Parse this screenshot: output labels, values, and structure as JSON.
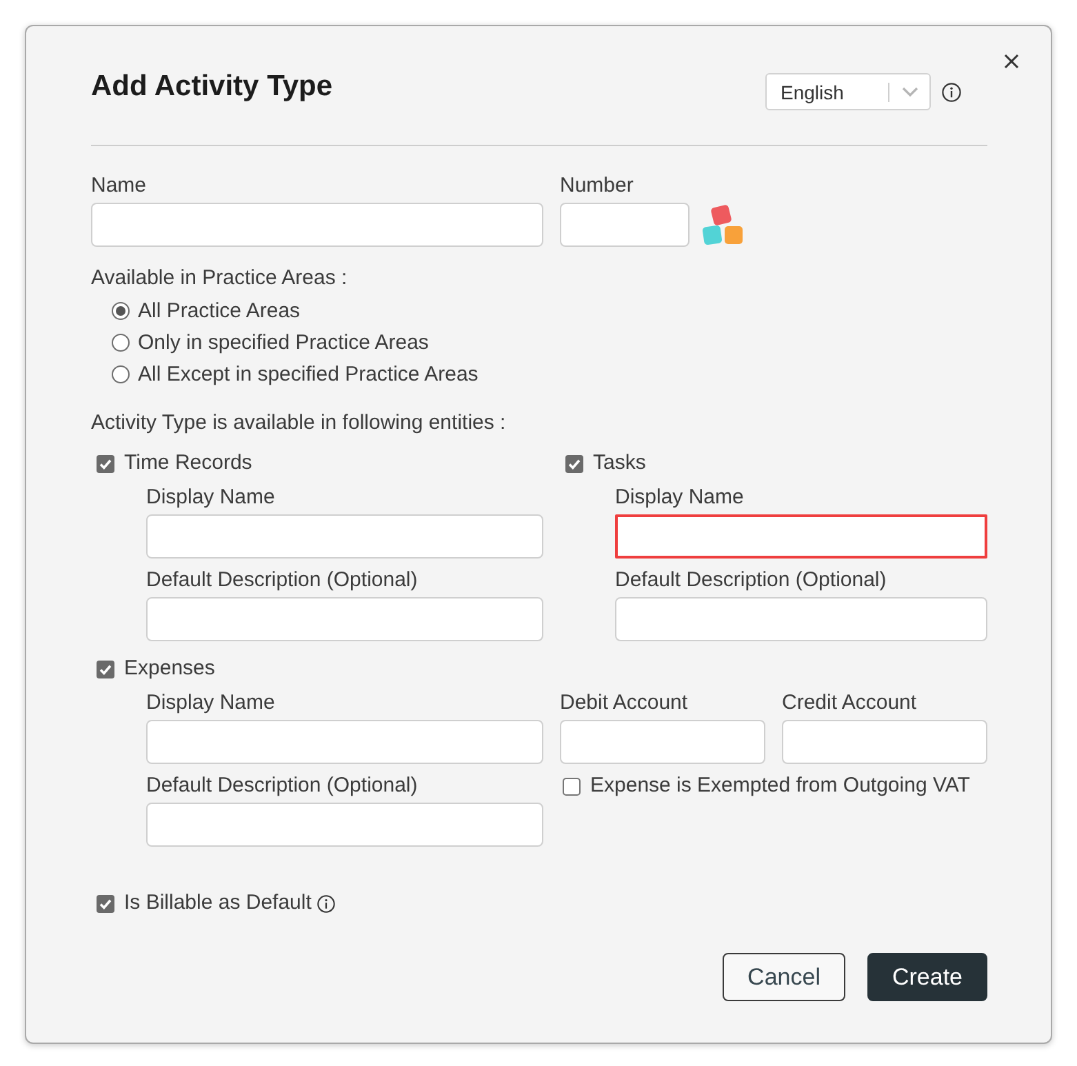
{
  "dialog": {
    "title": "Add Activity Type",
    "language_select": {
      "value": "English"
    }
  },
  "name_field": {
    "label": "Name"
  },
  "number_field": {
    "label": "Number"
  },
  "practice_areas": {
    "label": "Available in Practice Areas :",
    "options": [
      {
        "label": "All Practice Areas",
        "selected": true
      },
      {
        "label": "Only in specified Practice Areas",
        "selected": false
      },
      {
        "label": "All Except in specified Practice Areas",
        "selected": false
      }
    ]
  },
  "entities": {
    "label": "Activity Type is available in following entities :",
    "groups": [
      {
        "kind": "half",
        "label": "Time Records",
        "checked": true,
        "fields": [
          {
            "label": "Display Name",
            "error": false
          },
          {
            "label": "Default Description (Optional)",
            "error": false
          }
        ]
      },
      {
        "kind": "half",
        "label": "Tasks",
        "checked": true,
        "fields": [
          {
            "label": "Display Name",
            "error": true
          },
          {
            "label": "Default Description (Optional)",
            "error": false
          }
        ]
      },
      {
        "kind": "full",
        "label": "Expenses",
        "checked": true,
        "fields": [
          {
            "label": "Display Name",
            "error": false
          },
          {
            "label": "Default Description (Optional)",
            "error": false
          }
        ],
        "accounts": [
          {
            "label": "Debit Account",
            "error": false
          },
          {
            "label": "Credit Account",
            "error": false
          }
        ],
        "exemption": {
          "label": "Expense is Exempted from Outgoing VAT",
          "checked": false
        }
      }
    ]
  },
  "billable": {
    "label": "Is Billable as Default",
    "checked": true
  },
  "buttons": [
    {
      "label": "Cancel",
      "kind": "secondary"
    },
    {
      "label": "Create",
      "kind": "primary"
    }
  ]
}
